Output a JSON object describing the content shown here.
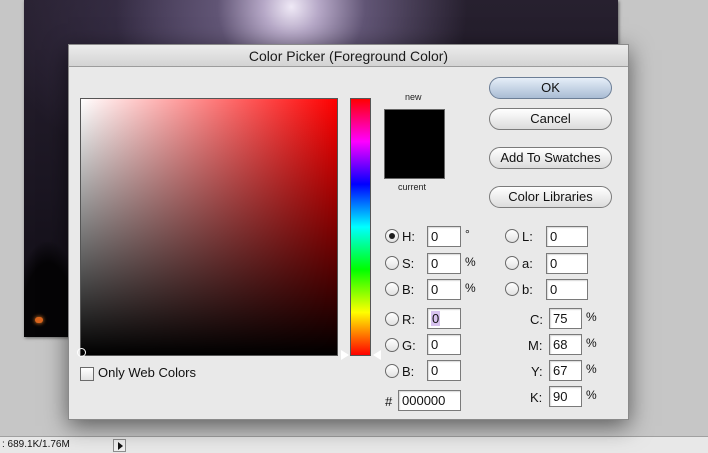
{
  "dialog": {
    "title": "Color Picker (Foreground Color)",
    "new_label": "new",
    "current_label": "current",
    "new_color": "#000000",
    "current_color": "#000000",
    "only_web_colors_label": "Only Web Colors",
    "only_web_colors_checked": false
  },
  "buttons": {
    "ok": "OK",
    "cancel": "Cancel",
    "add_to_swatches": "Add To Swatches",
    "color_libraries": "Color Libraries"
  },
  "hsb": {
    "h": {
      "label": "H:",
      "value": "0",
      "unit": "°",
      "selected": true
    },
    "s": {
      "label": "S:",
      "value": "0",
      "unit": "%",
      "selected": false
    },
    "b": {
      "label": "B:",
      "value": "0",
      "unit": "%",
      "selected": false
    }
  },
  "rgb": {
    "r": {
      "label": "R:",
      "value": "0",
      "selected": false
    },
    "g": {
      "label": "G:",
      "value": "0",
      "selected": false
    },
    "b": {
      "label": "B:",
      "value": "0",
      "selected": false
    }
  },
  "lab": {
    "l": {
      "label": "L:",
      "value": "0",
      "selected": false
    },
    "a": {
      "label": "a:",
      "value": "0",
      "selected": false
    },
    "b": {
      "label": "b:",
      "value": "0",
      "selected": false
    }
  },
  "cmyk": {
    "c": {
      "label": "C:",
      "value": "75",
      "unit": "%"
    },
    "m": {
      "label": "M:",
      "value": "68",
      "unit": "%"
    },
    "y": {
      "label": "Y:",
      "value": "67",
      "unit": "%"
    },
    "k": {
      "label": "K:",
      "value": "90",
      "unit": "%"
    }
  },
  "hex": {
    "label": "#",
    "value": "000000"
  },
  "status_bar": {
    "text": ": 689.1K/1.76M"
  }
}
